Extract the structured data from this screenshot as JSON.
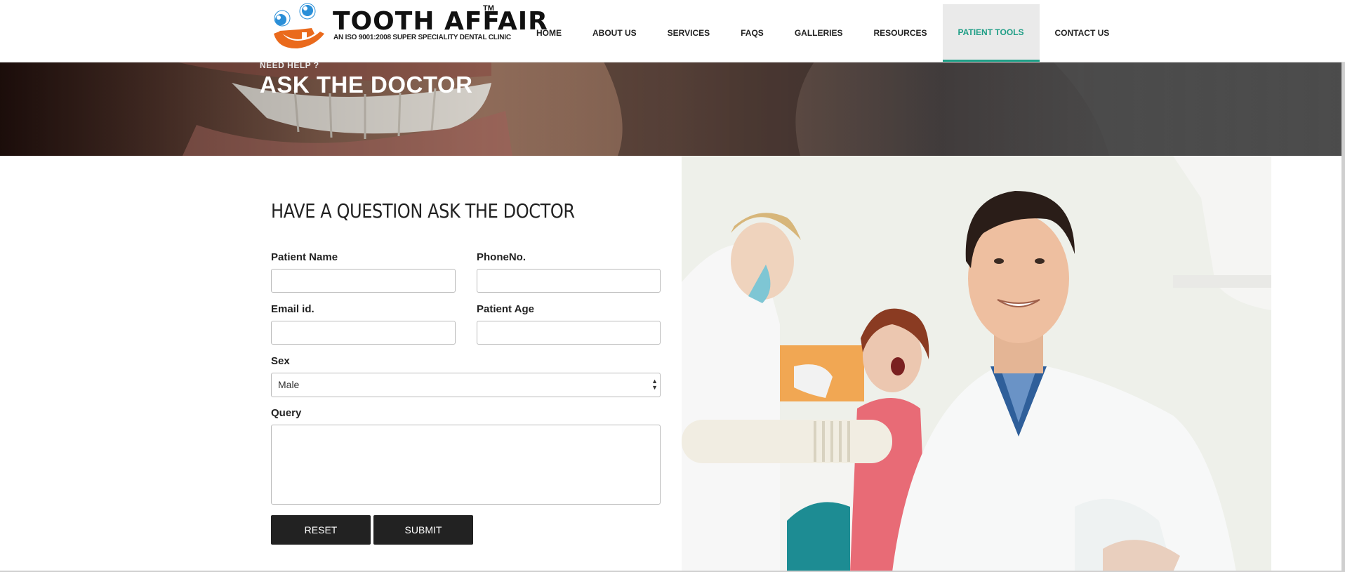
{
  "brand": {
    "name": "TOOTH AFFAIR",
    "tm": "TM",
    "tagline": "AN ISO 9001:2008 SUPER SPECIALITY DENTAL CLINIC"
  },
  "nav": {
    "items": [
      {
        "label": "HOME"
      },
      {
        "label": "ABOUT US"
      },
      {
        "label": "SERVICES"
      },
      {
        "label": "FAQS"
      },
      {
        "label": "GALLERIES"
      },
      {
        "label": "RESOURCES"
      },
      {
        "label": "PATIENT TOOLS",
        "active": true
      },
      {
        "label": "CONTACT US"
      }
    ]
  },
  "hero": {
    "pretitle": "NEED HELP ?",
    "title": "ASK THE DOCTOR"
  },
  "form": {
    "title": "HAVE A QUESTION ASK THE DOCTOR",
    "patient_name_label": "Patient Name",
    "patient_name_value": "",
    "phone_label": "PhoneNo.",
    "phone_value": "",
    "email_label": "Email id.",
    "email_value": "",
    "age_label": "Patient Age",
    "age_value": "",
    "sex_label": "Sex",
    "sex_value": "Male",
    "query_label": "Query",
    "query_value": "",
    "reset_label": "RESET",
    "submit_label": "SUBMIT"
  },
  "colors": {
    "accent": "#1f9e86",
    "button": "#222222",
    "logo_orange": "#ea6a1c",
    "logo_blue": "#2a8fd8"
  }
}
